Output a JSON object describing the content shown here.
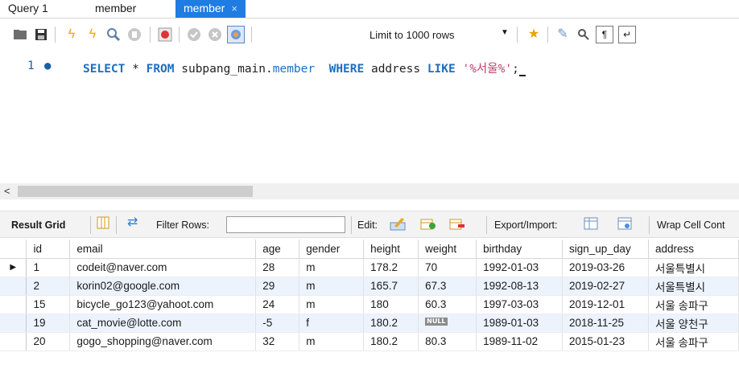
{
  "tabs": [
    {
      "label": "Query 1",
      "active": false
    },
    {
      "label": "member",
      "active": false
    },
    {
      "label": "member",
      "active": true
    }
  ],
  "tab_close_glyph": "×",
  "toolbar": {
    "limit_label": "Limit to 1000 rows",
    "icons": [
      "folder-icon",
      "save-icon",
      "execute-icon",
      "execute-current-icon",
      "explain-icon",
      "stop-icon",
      "toggle-error-icon",
      "commit-icon",
      "rollback-icon",
      "autocommit-icon",
      "limit-dropdown-icon",
      "beautify-icon",
      "format-icon",
      "find-icon",
      "invisible-chars-icon",
      "wrap-icon"
    ]
  },
  "editor": {
    "line_number": "1",
    "line_marker": "●",
    "kw_select": "SELECT",
    "star": " * ",
    "kw_from": "FROM",
    "schema": " subpang_main.",
    "table": "member",
    "kw_where": "  WHERE",
    "column": " address ",
    "kw_like": "LIKE",
    "pattern": " '%서울%'",
    "terminator": ";"
  },
  "result_toolbar": {
    "result_grid_label": "Result Grid",
    "filter_label": "Filter Rows:",
    "filter_value": "",
    "edit_label": "Edit:",
    "export_label": "Export/Import:",
    "wrap_label": "Wrap Cell Cont"
  },
  "grid": {
    "columns": [
      "id",
      "email",
      "age",
      "gender",
      "height",
      "weight",
      "birthday",
      "sign_up_day",
      "address"
    ],
    "null_label": "NULL",
    "current_row_marker": "▶",
    "rows": [
      [
        "1",
        "codeit@naver.com",
        "28",
        "m",
        "178.2",
        "70",
        "1992-01-03",
        "2019-03-26",
        "서울특별시"
      ],
      [
        "2",
        "korin02@google.com",
        "29",
        "m",
        "165.7",
        "67.3",
        "1992-08-13",
        "2019-02-27",
        "서울특별시"
      ],
      [
        "15",
        "bicycle_go123@yahoot.com",
        "24",
        "m",
        "180",
        "60.3",
        "1997-03-03",
        "2019-12-01",
        "서울 송파구"
      ],
      [
        "19",
        "cat_movie@lotte.com",
        "-5",
        "f",
        "180.2",
        null,
        "1989-01-03",
        "2018-11-25",
        "서울 양천구"
      ],
      [
        "20",
        "gogo_shopping@naver.com",
        "32",
        "m",
        "180.2",
        "80.3",
        "1989-11-02",
        "2015-01-23",
        "서울 송파구"
      ]
    ]
  },
  "colors": {
    "active_tab": "#1f7ce0",
    "keyword": "#1d6fc1",
    "string": "#c0406a",
    "row_alt": "#ecf3fd"
  }
}
